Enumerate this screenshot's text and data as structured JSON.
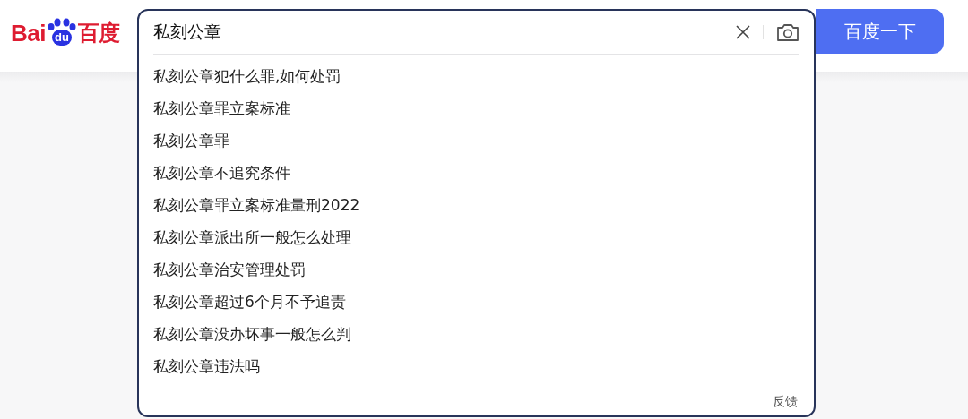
{
  "logo": {
    "left": "Bai",
    "mark": "du",
    "right": "百度"
  },
  "search": {
    "value": "私刻公章",
    "suggestions": [
      "私刻公章犯什么罪,如何处罚",
      "私刻公章罪立案标准",
      "私刻公章罪",
      "私刻公章不追究条件",
      "私刻公章罪立案标准量刑2022",
      "私刻公章派出所一般怎么处理",
      "私刻公章治安管理处罚",
      "私刻公章超过6个月不予追责",
      "私刻公章没办坏事一般怎么判",
      "私刻公章违法吗"
    ],
    "feedback": "反馈"
  },
  "button": "百度一下"
}
